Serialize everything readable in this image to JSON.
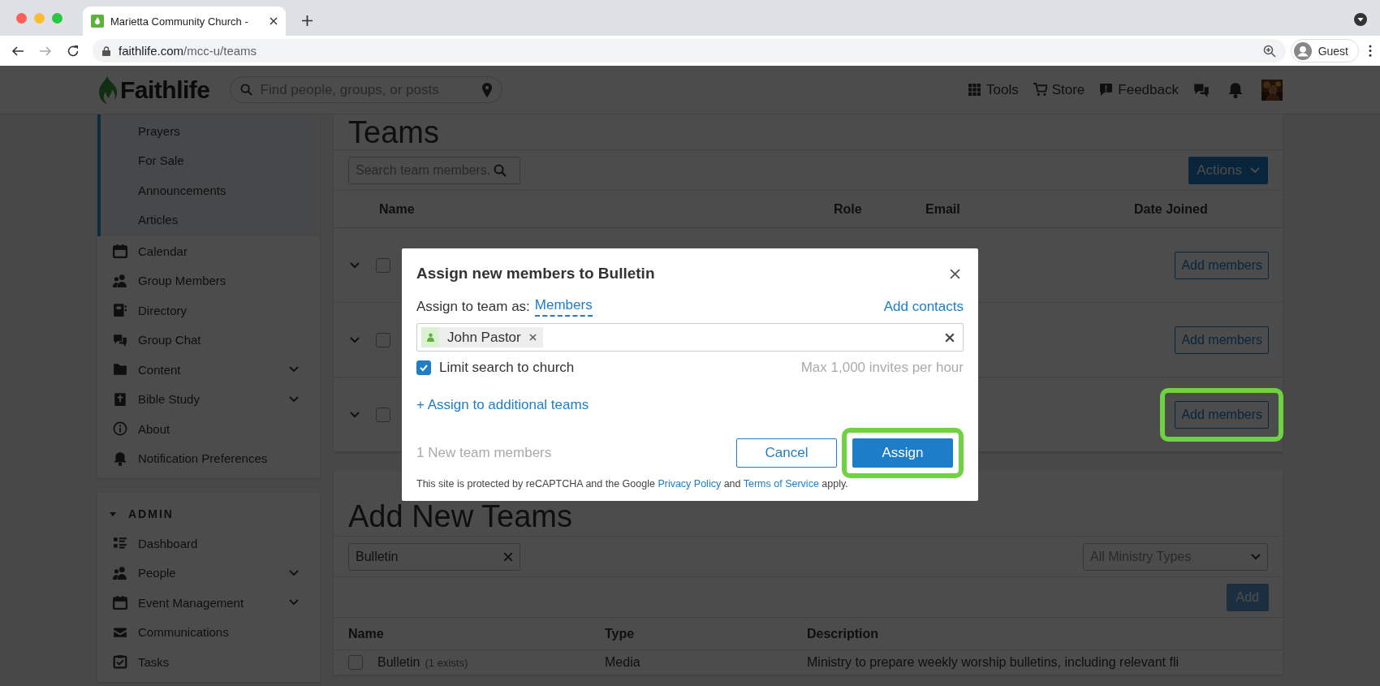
{
  "browser": {
    "tab_title": "Marietta Community Church -",
    "url": {
      "host": "faithlife.com",
      "path": "/mcc-u/teams"
    },
    "profile": "Guest"
  },
  "site_header": {
    "logo": "Faithlife",
    "search_placeholder": "Find people, groups, or posts",
    "nav": [
      {
        "label": "Tools"
      },
      {
        "label": "Store"
      },
      {
        "label": "Feedback"
      }
    ]
  },
  "sidebar": {
    "sub_items": [
      "Prayers",
      "For Sale",
      "Announcements",
      "Articles"
    ],
    "items": [
      {
        "label": "Calendar",
        "expandable": false
      },
      {
        "label": "Group Members",
        "expandable": false
      },
      {
        "label": "Directory",
        "expandable": false
      },
      {
        "label": "Group Chat",
        "expandable": false
      },
      {
        "label": "Content",
        "expandable": true
      },
      {
        "label": "Bible Study",
        "expandable": true
      },
      {
        "label": "About",
        "expandable": false
      },
      {
        "label": "Notification Preferences",
        "expandable": false
      }
    ],
    "admin": {
      "title": "ADMIN",
      "expanded": true,
      "items": [
        {
          "label": "Dashboard",
          "expandable": false
        },
        {
          "label": "People",
          "expandable": true
        },
        {
          "label": "Event Management",
          "expandable": true
        },
        {
          "label": "Communications",
          "expandable": false
        },
        {
          "label": "Tasks",
          "expandable": false
        }
      ]
    }
  },
  "teams": {
    "title": "Teams",
    "search_placeholder": "Search team members.",
    "actions": "Actions",
    "columns": [
      "Name",
      "Role",
      "Email",
      "Date Joined"
    ],
    "rows": [
      {
        "checked": false,
        "add_label": "Add members",
        "highlighted": false
      },
      {
        "checked": false,
        "add_label": "Add members",
        "highlighted": false
      },
      {
        "checked": false,
        "add_label": "Add members",
        "highlighted": true
      }
    ]
  },
  "add_teams": {
    "title": "Add New Teams",
    "name_value": "Bulletin",
    "type_select": "All Ministry Types",
    "add_button": "Add",
    "add_disabled": true,
    "columns": [
      "Name",
      "Type",
      "Description"
    ],
    "rows": [
      {
        "checked": false,
        "name": "Bulletin",
        "note": "(1 exists)",
        "type": "Media",
        "description": "Ministry to prepare weekly worship bulletins, including relevant fli"
      }
    ]
  },
  "modal": {
    "title": "Assign new members to Bulletin",
    "assign_as_label": "Assign to team as:",
    "role": "Members",
    "add_contacts": "Add contacts",
    "tokens": [
      {
        "name": "John Pastor"
      }
    ],
    "limit_label": "Limit search to church",
    "limit_checked": true,
    "rate_note": "Max 1,000 invites per hour",
    "additional": "+ Assign to additional teams",
    "count_note": "1 New team members",
    "cancel": "Cancel",
    "assign": "Assign",
    "assign_highlighted": true,
    "recaptcha": [
      {
        "kind": "text",
        "text": "This site is protected by reCAPTCHA and the Google "
      },
      {
        "kind": "link",
        "text": "Privacy Policy"
      },
      {
        "kind": "text",
        "text": " and "
      },
      {
        "kind": "link",
        "text": "Terms of Service"
      },
      {
        "kind": "text",
        "text": " apply."
      }
    ]
  }
}
